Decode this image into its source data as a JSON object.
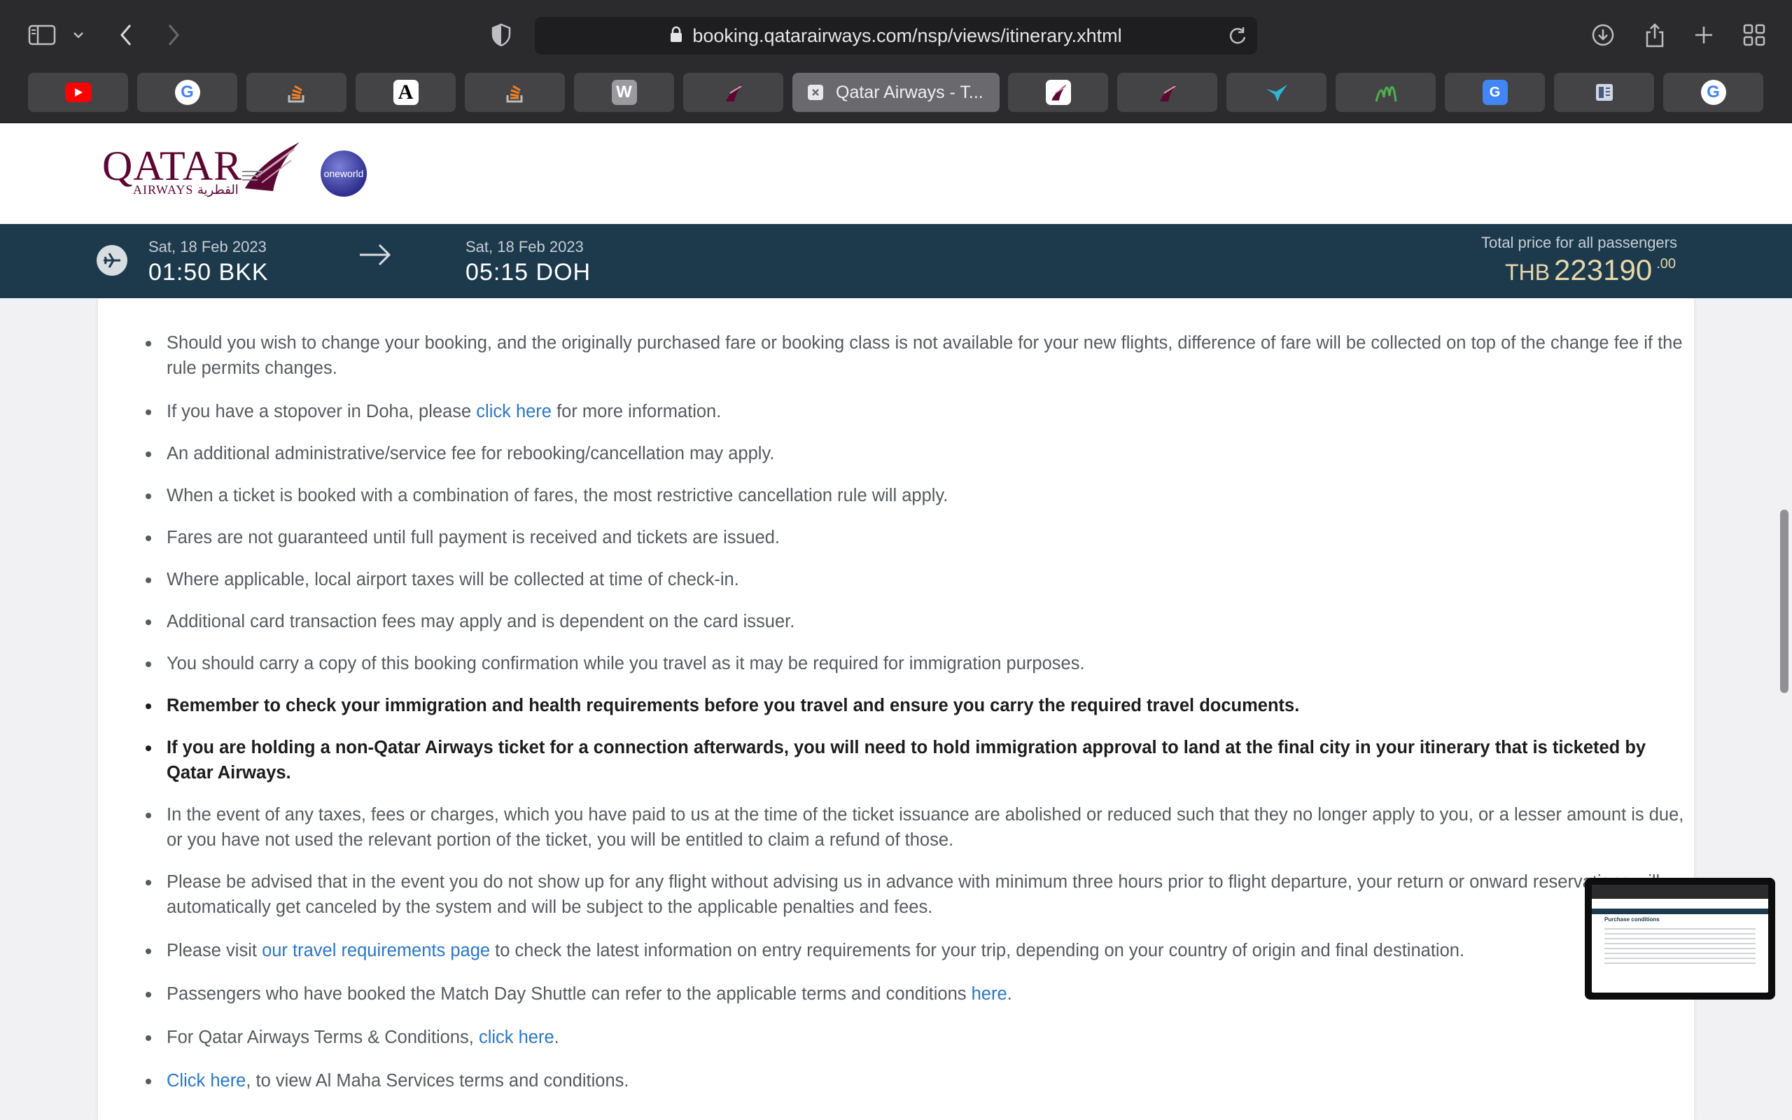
{
  "browser": {
    "url": "booking.qatarairways.com/nsp/views/itinerary.xhtml",
    "active_tab_title": "Qatar Airways - T...",
    "tabs": [
      {
        "icon": "youtube-icon",
        "color": "#ff0000"
      },
      {
        "icon": "google-icon",
        "color": "#4285f4"
      },
      {
        "icon": "stackoverflow-icon",
        "color": "#f48024"
      },
      {
        "icon": "font-a-icon",
        "color": "#ffffff"
      },
      {
        "icon": "stackoverflow-icon",
        "color": "#f48024"
      },
      {
        "icon": "w-icon",
        "color": "#9a9a9f"
      },
      {
        "icon": "qatar-oryx-icon",
        "color": "#5c0632"
      },
      {
        "icon": "qatar-oryx-icon",
        "color": "#5c0632"
      },
      {
        "icon": "qatar-oryx-icon",
        "color": "#5c0632"
      },
      {
        "icon": "bird-icon",
        "color": "#2fb6d6"
      },
      {
        "icon": "chart-icon",
        "color": "#4caf50"
      },
      {
        "icon": "google-translate-icon",
        "color": "#4285f4"
      },
      {
        "icon": "reader-icon",
        "color": "#cfd8e8"
      },
      {
        "icon": "google-icon",
        "color": "#4285f4"
      }
    ]
  },
  "brand": {
    "name": "QATAR",
    "sub": "AIRWAYS القطرية",
    "alliance": "oneworld",
    "color": "#5c0632"
  },
  "flight": {
    "depart_date": "Sat, 18 Feb 2023",
    "depart_time": "01:50 BKK",
    "arrive_date": "Sat, 18 Feb 2023",
    "arrive_time": "05:15 DOH",
    "price_label": "Total price for all passengers",
    "currency": "THB",
    "amount": "223190",
    "decimals": ".00"
  },
  "conditions": {
    "c1": "Should you wish to change your booking, and the originally purchased fare or booking class is not available for your new flights, difference of fare will be collected on top of the change fee if the rule permits changes.",
    "c2_pre": "If you have a stopover in Doha, please ",
    "c2_link": "click here",
    "c2_post": " for more information.",
    "c3": "An additional administrative/service fee for rebooking/cancellation may apply.",
    "c4": "When a ticket is booked with a combination of fares, the most restrictive cancellation rule will apply.",
    "c5": "Fares are not guaranteed until full payment is received and tickets are issued.",
    "c6": "Where applicable, local airport taxes will be collected at time of check-in.",
    "c7": "Additional card transaction fees may apply and is dependent on the card issuer.",
    "c8": "You should carry a copy of this booking confirmation while you travel as it may be required for immigration purposes.",
    "c9": "Remember to check your immigration and health requirements before you travel and ensure you carry the required travel documents.",
    "c10": "If you are holding a non-Qatar Airways ticket for a connection afterwards, you will need to hold immigration approval to land at the final city in your itinerary that is ticketed by Qatar Airways.",
    "c11": "In the event of any taxes, fees or charges, which you have paid to us at the time of the ticket issuance are abolished or reduced such that they no longer apply to you, or a lesser amount is due, or you have not used the relevant portion of the ticket, you will be entitled to claim a refund of those.",
    "c12": "Please be advised that in the event you do not show up for any flight without advising us in advance with minimum three hours prior to flight departure, your return or onward reservations will automatically get canceled by the system and will be subject to the applicable penalties and fees.",
    "c13_pre": "Please visit ",
    "c13_link": "our travel requirements page",
    "c13_post": " to check the latest information on entry requirements for your trip, depending on your country of origin and final destination.",
    "c14_pre": "Passengers who have booked the Match Day Shuttle can refer to the applicable terms and conditions ",
    "c14_link": "here",
    "c14_post": ".",
    "c15_pre": "For Qatar Airways Terms & Conditions, ",
    "c15_link": "click here",
    "c15_post": ".",
    "c16_link": "Click here",
    "c16_post": ", to view Al Maha Services terms and conditions."
  },
  "preview": {
    "title": "Purchase conditions"
  }
}
